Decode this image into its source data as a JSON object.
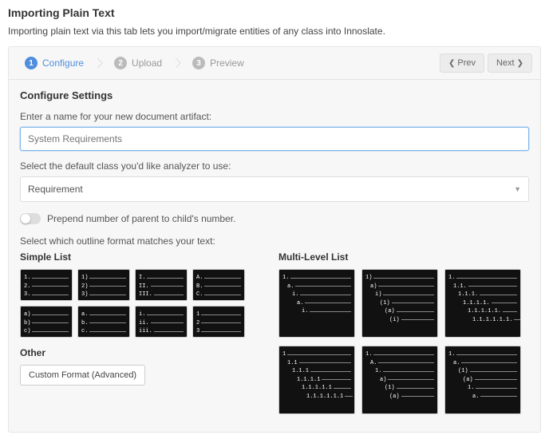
{
  "header": {
    "title": "Importing Plain Text",
    "intro": "Importing plain text via this tab lets you import/migrate entities of any class into Innoslate."
  },
  "stepper": {
    "steps": [
      {
        "num": "1",
        "label": "Configure"
      },
      {
        "num": "2",
        "label": "Upload"
      },
      {
        "num": "3",
        "label": "Preview"
      }
    ],
    "prev": "Prev",
    "next": "Next"
  },
  "configure": {
    "heading": "Configure Settings",
    "name_label": "Enter a name for your new document artifact:",
    "name_placeholder": "System Requirements",
    "class_label": "Select the default class you'd like analyzer to use:",
    "class_value": "Requirement",
    "toggle_label": "Prepend number of parent to child's number.",
    "outline_label": "Select which outline format matches your text:"
  },
  "simple": {
    "heading": "Simple List",
    "other_heading": "Other",
    "custom_btn": "Custom Format (Advanced)",
    "tiles": [
      [
        "1.",
        "2.",
        "3."
      ],
      [
        "1)",
        "2)",
        "3)"
      ],
      [
        "I.",
        "II.",
        "III."
      ],
      [
        "A.",
        "B.",
        "C."
      ],
      [
        "a)",
        "b)",
        "c)"
      ],
      [
        "a.",
        "b.",
        "c."
      ],
      [
        "i.",
        "ii.",
        "iii."
      ],
      [
        "1",
        "2",
        "3"
      ]
    ]
  },
  "multi": {
    "heading": "Multi-Level List",
    "tiles_top": [
      [
        {
          "i": 0,
          "t": "1."
        },
        {
          "i": 1,
          "t": "a."
        },
        {
          "i": 2,
          "t": "i."
        },
        {
          "i": 3,
          "t": "a."
        },
        {
          "i": 4,
          "t": "i."
        }
      ],
      [
        {
          "i": 0,
          "t": "1)"
        },
        {
          "i": 1,
          "t": "a)"
        },
        {
          "i": 2,
          "t": "i)"
        },
        {
          "i": 3,
          "t": "(1)"
        },
        {
          "i": 4,
          "t": "(a)"
        },
        {
          "i": 5,
          "t": "(i)"
        }
      ],
      [
        {
          "i": 0,
          "t": "1."
        },
        {
          "i": 1,
          "t": "1.1."
        },
        {
          "i": 2,
          "t": "1.1.1."
        },
        {
          "i": 3,
          "t": "1.1.1.1."
        },
        {
          "i": 4,
          "t": "1.1.1.1.1."
        },
        {
          "i": 5,
          "t": "1.1.1.1.1.1."
        }
      ]
    ],
    "tiles_bottom": [
      [
        {
          "i": 0,
          "t": "1"
        },
        {
          "i": 1,
          "t": "1.1"
        },
        {
          "i": 2,
          "t": "1.1.1"
        },
        {
          "i": 3,
          "t": "1.1.1.1"
        },
        {
          "i": 4,
          "t": "1.1.1.1.1"
        },
        {
          "i": 5,
          "t": "1.1.1.1.1.1"
        }
      ],
      [
        {
          "i": 0,
          "t": "1."
        },
        {
          "i": 1,
          "t": "A."
        },
        {
          "i": 2,
          "t": "1."
        },
        {
          "i": 3,
          "t": "a)"
        },
        {
          "i": 4,
          "t": "(1)"
        },
        {
          "i": 5,
          "t": "(a)"
        }
      ],
      [
        {
          "i": 0,
          "t": "1."
        },
        {
          "i": 1,
          "t": "a."
        },
        {
          "i": 2,
          "t": "(1)"
        },
        {
          "i": 3,
          "t": "(a)"
        },
        {
          "i": 4,
          "t": "1."
        },
        {
          "i": 5,
          "t": "a."
        }
      ]
    ]
  }
}
